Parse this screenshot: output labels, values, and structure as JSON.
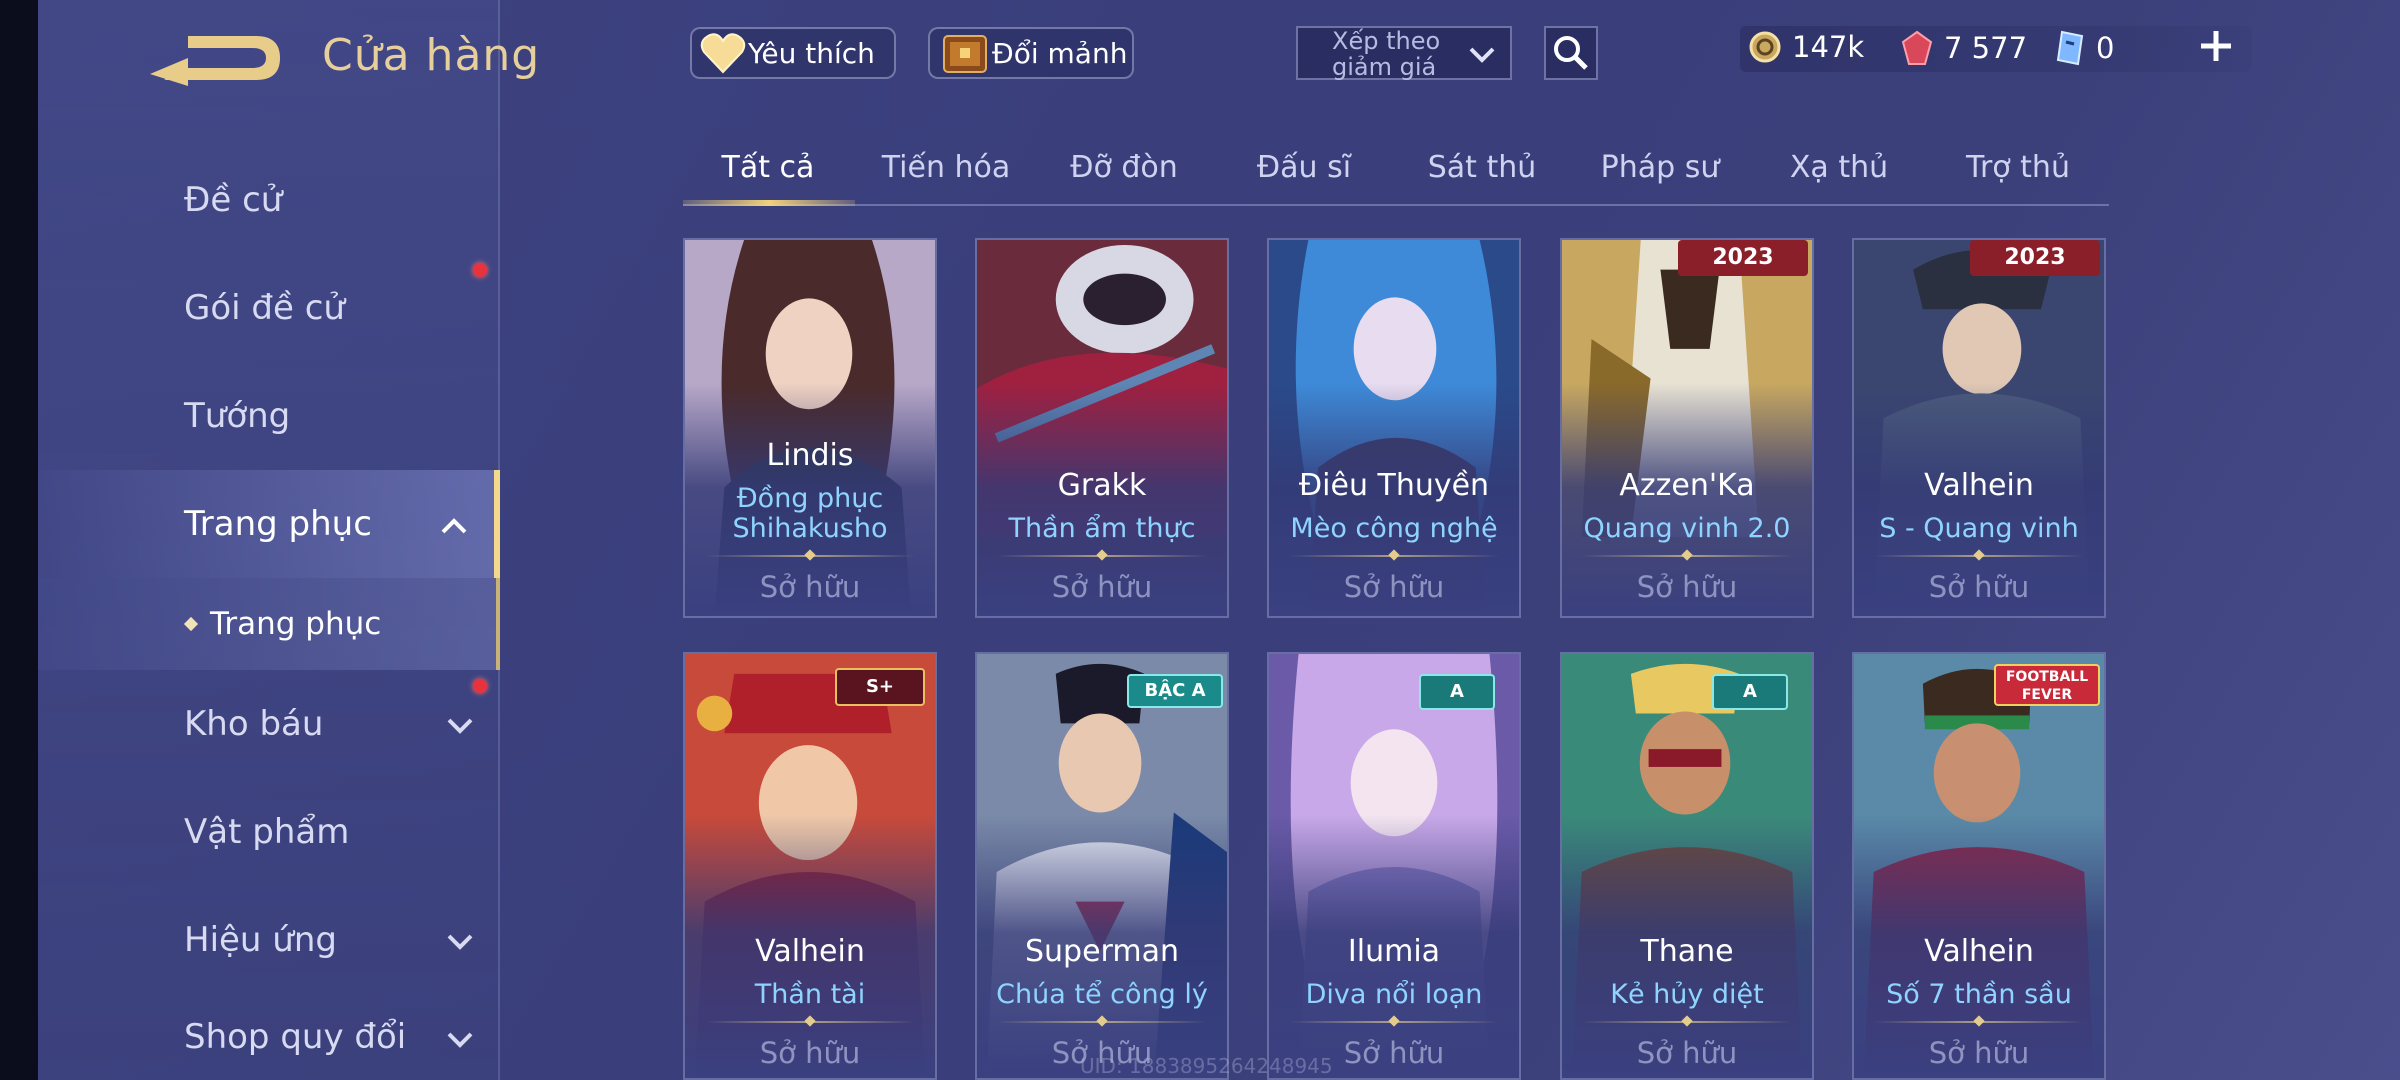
{
  "header": {
    "title": "Cửa hàng",
    "favorite_label": "Yêu thích",
    "exchange_label": "Đổi mảnh",
    "sort_label_line1": "Xếp theo",
    "sort_label_line2": "giảm giá"
  },
  "currencies": [
    {
      "icon": "gold-coin-icon",
      "value": "147k"
    },
    {
      "icon": "red-gem-icon",
      "value": "7 577"
    },
    {
      "icon": "blue-voucher-icon",
      "value": "0"
    }
  ],
  "sidebar": {
    "items": [
      {
        "label": "Đề cử"
      },
      {
        "label": "Gói đề cử"
      },
      {
        "label": "Tướng"
      },
      {
        "label": "Trang phục"
      },
      {
        "label": "Kho báu"
      },
      {
        "label": "Vật phẩm"
      },
      {
        "label": "Hiệu ứng"
      },
      {
        "label": "Shop quy đổi"
      }
    ],
    "sub_item": "Trang phục"
  },
  "tabs": [
    "Tất cả",
    "Tiến hóa",
    "Đỡ đòn",
    "Đấu sĩ",
    "Sát thủ",
    "Pháp sư",
    "Xạ thủ",
    "Trợ thủ"
  ],
  "active_tab": "Tất cả",
  "cards": [
    {
      "hero": "Lindis",
      "skin_line1": "Đồng phục",
      "skin_line2": "Shihakusho",
      "status": "Sở hữu"
    },
    {
      "hero": "Grakk",
      "skin_line1": "Thần ẩm thực",
      "skin_line2": "",
      "status": "Sở hữu"
    },
    {
      "hero": "Điêu Thuyền",
      "skin_line1": "Mèo công nghệ",
      "skin_line2": "",
      "status": "Sở hữu"
    },
    {
      "hero": "Azzen'Ka",
      "skin_line1": "Quang vinh 2.0",
      "skin_line2": "",
      "status": "Sở hữu",
      "badge": "2023"
    },
    {
      "hero": "Valhein",
      "skin_line1": "S - Quang vinh",
      "skin_line2": "",
      "status": "Sở hữu",
      "badge": "2023"
    },
    {
      "hero": "Valhein",
      "skin_line1": "Thần tài",
      "skin_line2": "",
      "status": "Sở hữu",
      "badge": "S+"
    },
    {
      "hero": "Superman",
      "skin_line1": "Chúa tể công lý",
      "skin_line2": "",
      "status": "Sở hữu",
      "badge": "BẬC A"
    },
    {
      "hero": "Ilumia",
      "skin_line1": "Diva nổi loạn",
      "skin_line2": "",
      "status": "Sở hữu",
      "badge": "A"
    },
    {
      "hero": "Thane",
      "skin_line1": "Kẻ hủy diệt",
      "skin_line2": "",
      "status": "Sở hữu",
      "badge": "A"
    },
    {
      "hero": "Valhein",
      "skin_line1": "Số 7 thần sầu",
      "skin_line2": "",
      "status": "Sở hữu",
      "badge": "FOOTBALL FEVER"
    }
  ],
  "uid_text": "UID: 1883895264248945",
  "colors": {
    "accent_gold": "#f2d27c",
    "skin_name_blue": "#8fd4ff",
    "notification_red": "#e8323c"
  }
}
